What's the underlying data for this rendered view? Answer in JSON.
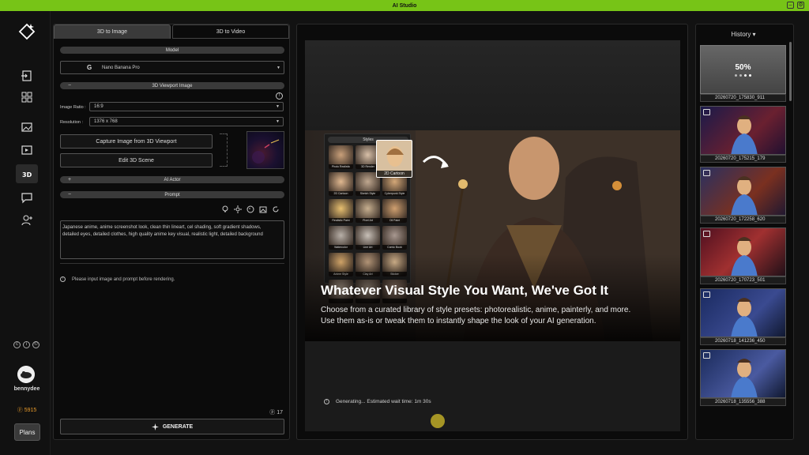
{
  "app": {
    "title": "AI Studio"
  },
  "user": {
    "name": "bennydee",
    "credits": "5915",
    "plans_label": "Plans"
  },
  "tabs": [
    {
      "label": "3D to Image"
    },
    {
      "label": "3D to Video"
    }
  ],
  "model": {
    "section_label": "Model",
    "selected": "Nano Banana Pro"
  },
  "viewport": {
    "section_label": "3D Viewport Image",
    "ratio_label": "Image Ratio :",
    "ratio_value": "16:9",
    "resolution_label": "Resolution :",
    "resolution_value": "1376 x 768",
    "capture_label": "Capture Image from 3D Viewport",
    "edit_label": "Edit 3D Scene"
  },
  "ai_actor": {
    "section_label": "AI Actor"
  },
  "prompt": {
    "section_label": "Prompt",
    "line1": "Japanese anime, anime screenshot look, clean thin lineart, cel shading, soft gradient shadows,",
    "line2": "detailed eyes, detailed clothes, high quality anime key visual, realistic light, detailed background"
  },
  "hint": "Please input image and prompt before rendering.",
  "token_count": "17",
  "generate_label": "GENERATE",
  "preview": {
    "styles_header": "Styles",
    "style_cells": [
      "Photo Realistic",
      "3D Render",
      "",
      "2D Cartoon",
      "Sketch Style",
      "Cyberpunk Style",
      "Realistic Paint",
      "Pixel Art",
      "Oil Paint",
      "Watercolor",
      "Line Art",
      "Comic Book",
      "Anime Style",
      "Clay Art",
      "Sticker",
      "",
      "",
      ""
    ],
    "selected_style": "2D Cartoon",
    "title": "Whatever Visual Style You Want, We've Got It",
    "desc_line1": "Choose from a curated library of style presets: photorealistic, anime, painterly, and more.",
    "desc_line2": "Use them as-is or tweak them to instantly shape the look of your AI generation.",
    "status": "Generating... Estimated wait time: 1m 30s"
  },
  "history": {
    "title": "History",
    "progress": "50%",
    "items": [
      {
        "label": "20260720_175830_911"
      },
      {
        "label": "20260720_175215_179"
      },
      {
        "label": "20260720_172258_620"
      },
      {
        "label": "20260720_170723_501"
      },
      {
        "label": "20260718_141236_450"
      },
      {
        "label": "20260718_135556_388"
      }
    ]
  },
  "colors": {
    "accent": "#77c417",
    "credits": "#e89a2a"
  }
}
